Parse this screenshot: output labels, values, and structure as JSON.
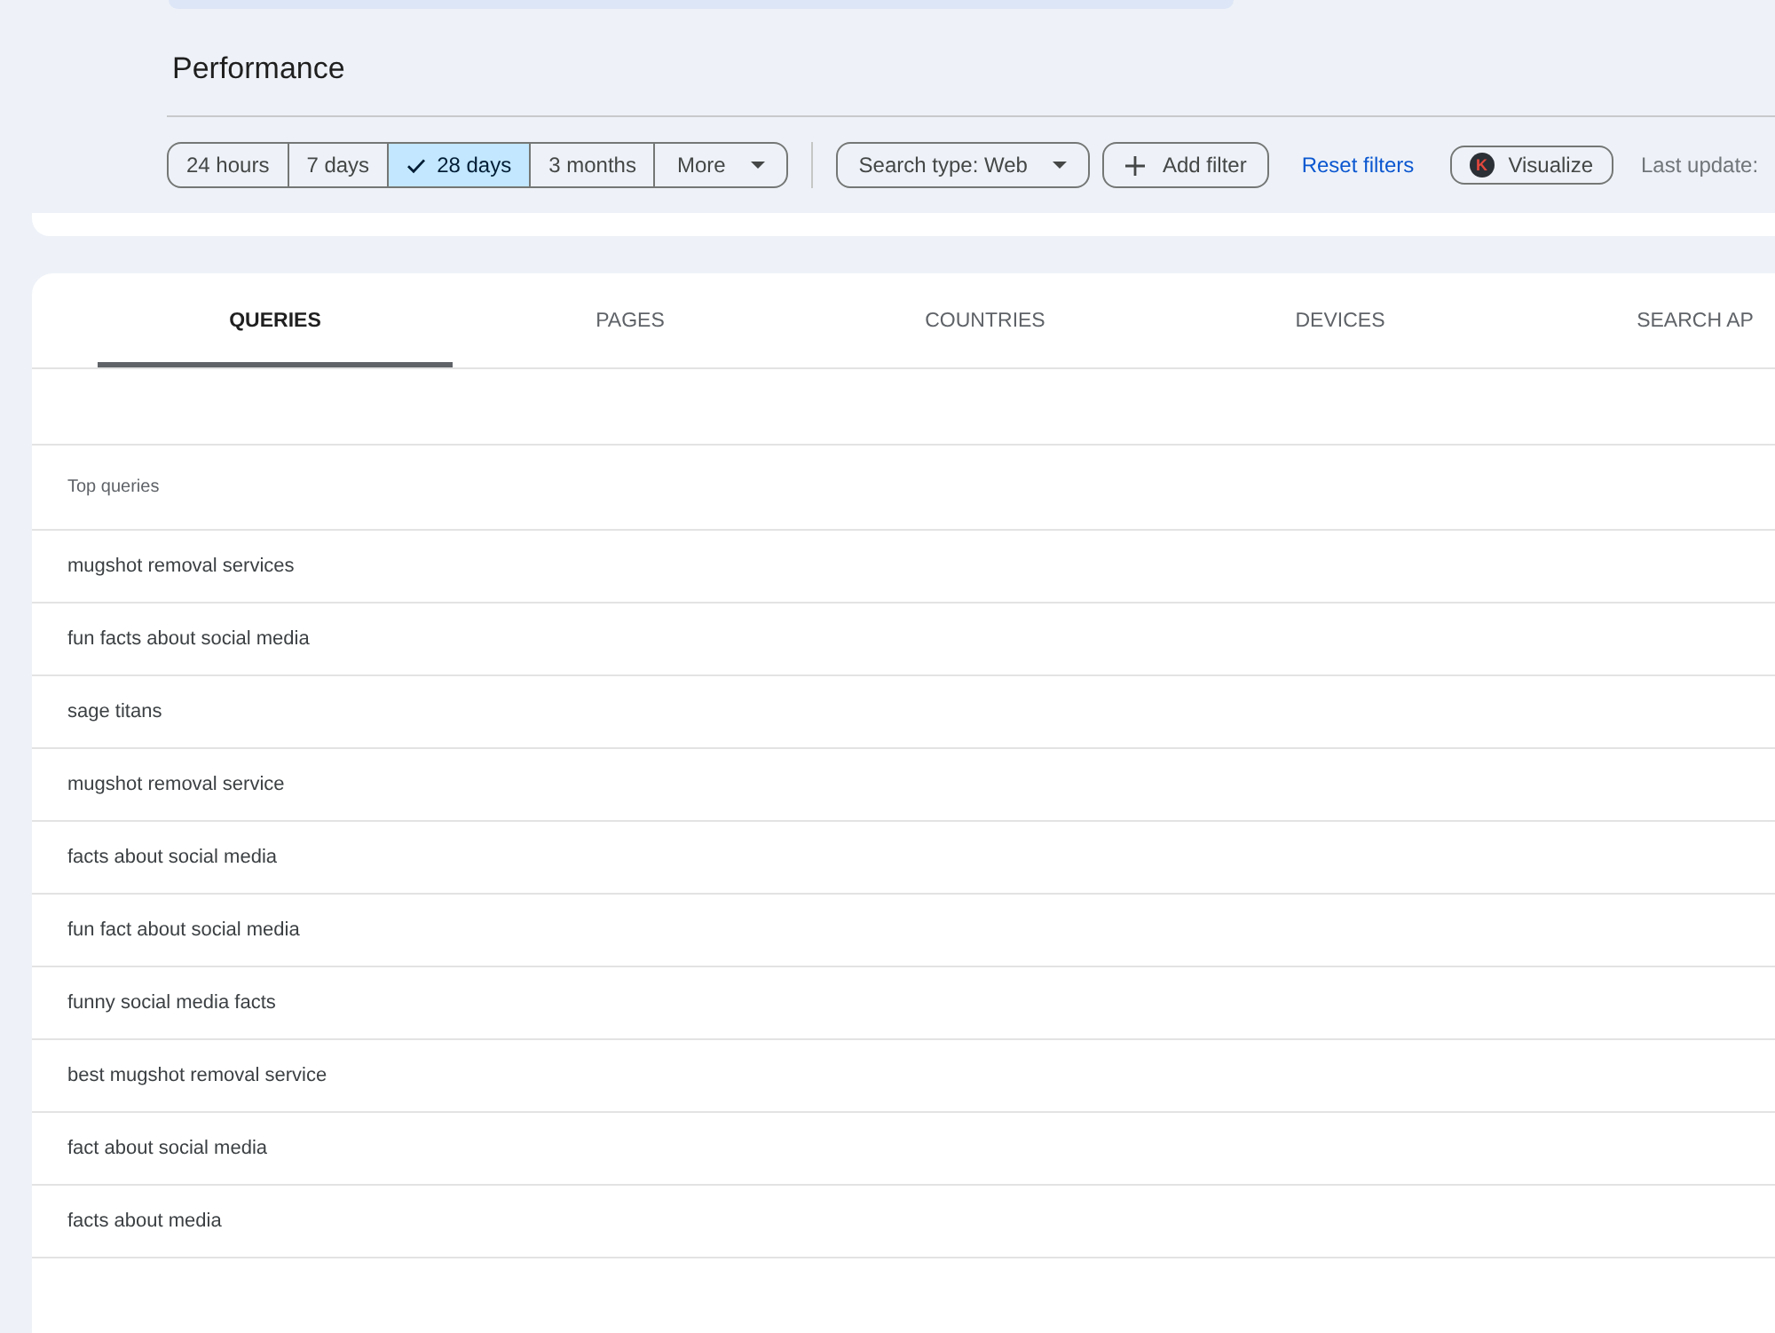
{
  "page_title": "Performance",
  "date_range": {
    "options": [
      {
        "label": "24 hours",
        "selected": false
      },
      {
        "label": "7 days",
        "selected": false
      },
      {
        "label": "28 days",
        "selected": true
      },
      {
        "label": "3 months",
        "selected": false
      }
    ],
    "more": "More"
  },
  "filters": {
    "search_type": "Search type: Web",
    "add_filter": "Add filter",
    "reset": "Reset filters"
  },
  "visualize": {
    "label": "Visualize",
    "logo_letter": "K"
  },
  "last_update": "Last update:",
  "tabs": [
    {
      "label": "QUERIES",
      "selected": true
    },
    {
      "label": "PAGES",
      "selected": false
    },
    {
      "label": "COUNTRIES",
      "selected": false
    },
    {
      "label": "DEVICES",
      "selected": false
    },
    {
      "label": "SEARCH AP",
      "selected": false
    }
  ],
  "table": {
    "column": "Top queries",
    "rows": [
      "mugshot removal services",
      "fun facts about social media",
      "sage titans",
      "mugshot removal service",
      "facts about social media",
      "fun fact about social media",
      "funny social media facts",
      "best mugshot removal service",
      "fact about social media",
      "facts about media"
    ]
  }
}
